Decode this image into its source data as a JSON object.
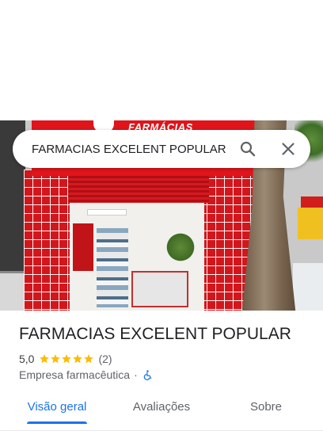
{
  "search": {
    "query": "FARMACIAS EXCELENT POPULAR",
    "search_icon": "search-icon",
    "close_icon": "close-icon"
  },
  "photo": {
    "sign_text": "FARMÁCIAS"
  },
  "place": {
    "title": "FARMACIAS EXCELENT POPULAR",
    "rating": "5,0",
    "stars": 5,
    "review_count": "(2)",
    "category": "Empresa farmacêutica",
    "separator": "·",
    "accessibility_icon": "wheelchair-icon"
  },
  "tabs": [
    {
      "label": "Visão geral",
      "selected": true
    },
    {
      "label": "Avaliações",
      "selected": false
    },
    {
      "label": "Sobre",
      "selected": false
    }
  ],
  "colors": {
    "accent": "#1a73e8",
    "star": "#fbbc04",
    "storefront_red": "#d2161c"
  }
}
